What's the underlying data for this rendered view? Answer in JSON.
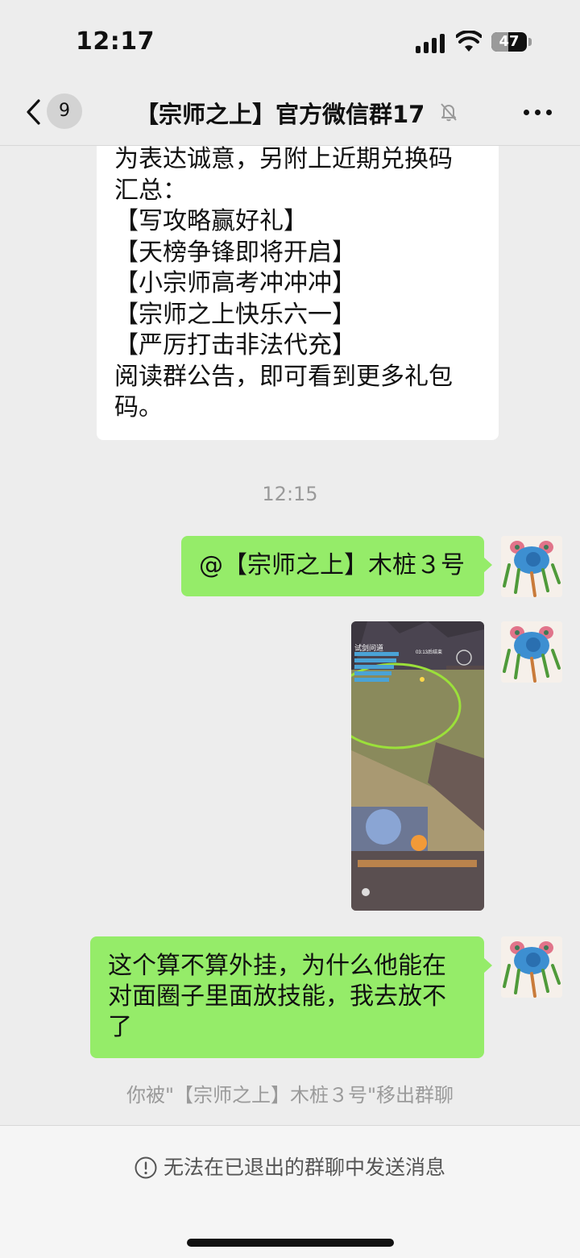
{
  "status_bar": {
    "time": "12:17",
    "battery_level": "47",
    "battery_fraction": 0.47
  },
  "header": {
    "unread_count": "9",
    "title": "【宗师之上】官方微信群17"
  },
  "messages": {
    "incoming_lines": [
      "为表达诚意，另附上近期兑换码",
      "汇总：",
      "【写攻略赢好礼】",
      "【天榜争锋即将开启】",
      "【小宗师高考冲冲冲】",
      "【宗师之上快乐六一】",
      "【严厉打击非法代充】",
      "阅读群公告，即可看到更多礼包",
      "码。"
    ],
    "timestamp": "12:15",
    "mention_text": "@【宗师之上】木桩３号",
    "question_lines": [
      "这个算不算外挂，为什么他能在",
      "对面圈子里面放技能，我去放不",
      "了"
    ]
  },
  "game_screenshot": {
    "mode_label": "试剑问道",
    "timer_label": "03:13后结束",
    "colors": {
      "field": "#7e8a55",
      "ring": "#9be03a",
      "wall": "#6b5a55"
    }
  },
  "system_notice": "你被\"【宗师之上】木桩３号\"移出群聊",
  "footer": {
    "notice": "无法在已退出的群聊中发送消息"
  },
  "colors": {
    "outgoing_bubble": "#95ec69",
    "background": "#ededed",
    "footer": "#f5f5f5"
  }
}
